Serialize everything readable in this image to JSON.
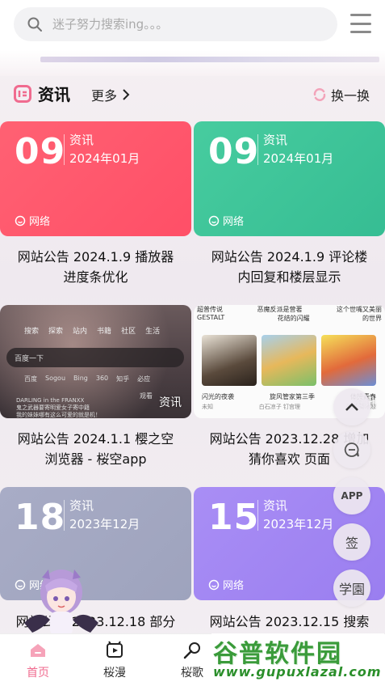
{
  "search": {
    "placeholder": "迷子努力搜索ing。。。"
  },
  "section": {
    "title": "资讯",
    "more": "更多",
    "swap": "换一换"
  },
  "cards": [
    {
      "day": "09",
      "category": "资讯",
      "year_month": "2024年01月",
      "tag": "网络",
      "title_line1": "网站公告 2024.1.9 播放器",
      "title_line2": "进度条优化",
      "color": "#ff5a6e"
    },
    {
      "day": "09",
      "category": "资讯",
      "year_month": "2024年01月",
      "tag": "网络",
      "title_line1": "网站公告 2024.1.9 评论楼",
      "title_line2": "内回复和楼层显示",
      "color": "#3ec59a"
    },
    {
      "badge": "资讯",
      "title_line1": "网站公告 2024.1.1 樱之空",
      "title_line2": "浏览器 - 桜空app",
      "thumb": {
        "nav": [
          "搜索",
          "探索",
          "站内",
          "书籍",
          "社区",
          "生活"
        ],
        "search_text": "百度一下",
        "engines": [
          "百度",
          "Sogou",
          "Bing",
          "360",
          "知乎",
          "必应"
        ],
        "caption1": "DARLING in the FRANXX",
        "caption2": "鬼之武器要寄明爱女子寄中籍",
        "caption3": "我的妹妹哪有这么可爱的就是机！",
        "watch": "观看"
      }
    },
    {
      "badge": "资讯",
      "title_line1": "网站公告 2023.12.28 增加",
      "title_line2": "猜你喜欢 页面",
      "thumb": {
        "top_labels": [
          "超普传说",
          "恶魔反派是营著",
          "这个世嘴又美丽"
        ],
        "top_labels2": [
          "GESTALT",
          "花结的闪耀",
          "的世界"
        ],
        "covers": [
          "闪光的夜袭",
          "旋风管家第三季",
          "体操青春"
        ],
        "subs": [
          "未知",
          "白石凉子 钉宫理",
          "张川 菊地凉"
        ]
      }
    },
    {
      "day": "18",
      "category": "资讯",
      "year_month": "2023年12月",
      "tag": "网络",
      "title_line1": "网站公告 2023.12.18 部分",
      "color": "#a3a8c2"
    },
    {
      "day": "15",
      "category": "资讯",
      "year_month": "2023年12月",
      "tag": "网络",
      "title_line1": "网站公告 2023.12.15 搜索",
      "color": "#a286f2"
    }
  ],
  "fabs": {
    "app": "APP",
    "sign": "签",
    "school": "学園"
  },
  "tabs": [
    {
      "label": "首页"
    },
    {
      "label": "桜漫"
    },
    {
      "label": "桜歌"
    }
  ],
  "watermark": {
    "cn": "谷普软件园",
    "url": "www.gupuxlazal.com"
  },
  "colors": {
    "accent": "#f06b8f",
    "red_card": "#ff5a6e",
    "green_card": "#3ec59a",
    "grey_card": "#a3a8c2",
    "purple_card": "#a286f2"
  }
}
